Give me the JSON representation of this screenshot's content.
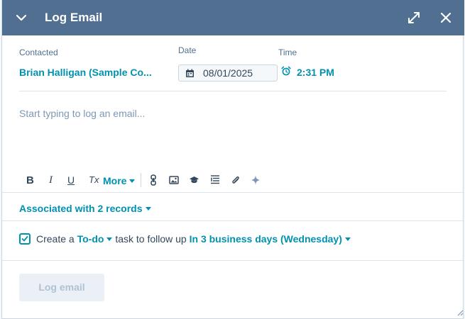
{
  "header": {
    "title": "Log Email",
    "background": "#516f90"
  },
  "fields": {
    "contacted_label": "Contacted",
    "contacted_value": "Brian Halligan (Sample Co...",
    "date_label": "Date",
    "date_value": "08/01/2025",
    "time_label": "Time",
    "time_value": "2:31 PM"
  },
  "editor": {
    "placeholder": "Start typing to log an email..."
  },
  "toolbar": {
    "bold": "B",
    "italic": "I",
    "underline": "U",
    "clear_format": "Tx",
    "more_label": "More",
    "icons": [
      "bold-icon",
      "italic-icon",
      "underline-icon",
      "clear-format-icon",
      "link-icon",
      "image-icon",
      "knowledge-base-icon",
      "snippet-icon",
      "attachment-icon",
      "ai-sparkle-icon"
    ]
  },
  "associations": {
    "label": "Associated with 2 records"
  },
  "task": {
    "checked": true,
    "prefix": "Create a",
    "type": "To-do",
    "middle": "task to follow up",
    "due": "In 3 business days (Wednesday)"
  },
  "footer": {
    "log_button": "Log email"
  },
  "colors": {
    "accent": "#0091ae",
    "text": "#33475b",
    "muted": "#516f90",
    "placeholder": "#7c98b6"
  }
}
